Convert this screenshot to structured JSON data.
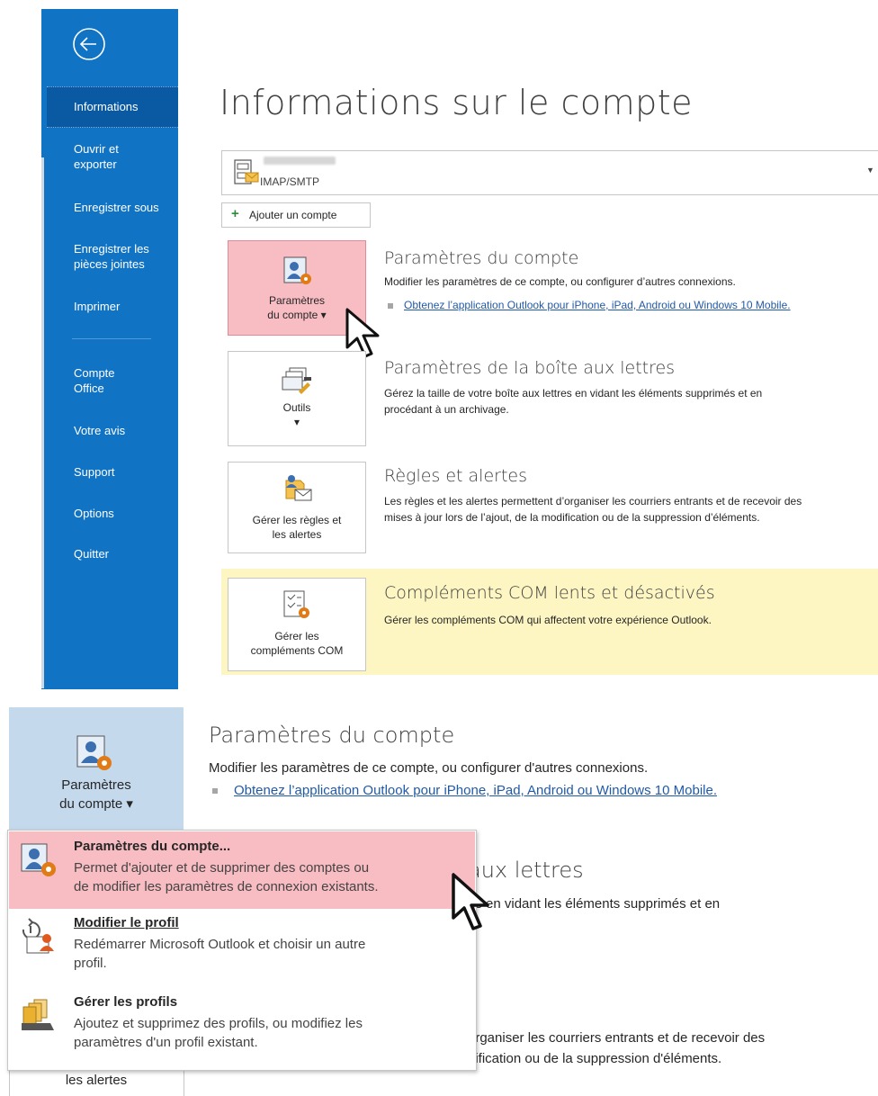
{
  "sidebar": {
    "items": [
      {
        "label": "Informations"
      },
      {
        "label": "Ouvrir et\nexporter"
      },
      {
        "label": "Enregistrer sous"
      },
      {
        "label": "Enregistrer les\npièces jointes"
      },
      {
        "label": "Imprimer"
      },
      {
        "label": "Compte\nOffice"
      },
      {
        "label": "Votre avis"
      },
      {
        "label": "Support"
      },
      {
        "label": "Options"
      },
      {
        "label": "Quitter"
      }
    ]
  },
  "main": {
    "title": "Informations sur le compte",
    "account": {
      "type": "IMAP/SMTP"
    },
    "add_account_label": "Ajouter un compte",
    "sections": [
      {
        "tile_label": "Paramètres\ndu compte ▾",
        "heading": "Paramètres du compte",
        "description": "Modifier les paramètres de ce compte, ou configurer d’autres connexions.",
        "link": "Obtenez l’application Outlook pour iPhone, iPad, Android ou Windows 10 Mobile."
      },
      {
        "tile_label": "Outils\n▾",
        "heading": "Paramètres de la boîte aux lettres",
        "description": "Gérez la taille de votre boîte aux lettres en vidant les éléments supprimés et en\nprocédant à un archivage."
      },
      {
        "tile_label": "Gérer les règles et\nles alertes",
        "heading": "Règles et alertes",
        "description": "Les règles et les alertes permettent d’organiser les courriers entrants et de recevoir des\nmises à jour lors de l’ajout, de la modification ou de la suppression d’éléments."
      },
      {
        "tile_label": "Gérer les\ncompléments COM",
        "heading": "Compléments COM lents et désactivés",
        "description": "Gérer les compléments COM qui affectent votre expérience Outlook."
      }
    ]
  },
  "zoom": {
    "tile_label": "Paramètres\ndu compte ▾",
    "heading": "Paramètres du compte",
    "description": "Modifier les paramètres de ce compte, ou configurer d'autres connexions.",
    "link": "Obtenez l’application Outlook pour iPhone, iPad, Android ou Windows 10 Mobile.",
    "behind_heading": "aux lettres",
    "behind_text1": "es en vidant les éléments supprimés et en",
    "behind_text2": "organiser les courriers entrants et de recevoir des",
    "behind_text3": "dification ou de la suppression d'éléments.",
    "bottom_tile_label": "les alertes",
    "menu": [
      {
        "title": "Paramètres du compte...",
        "desc": "Permet d'ajouter et de supprimer des comptes ou\nde modifier les paramètres de connexion existants."
      },
      {
        "title": "Modifier le profil",
        "desc": "Redémarrer Microsoft Outlook et choisir un autre\nprofil."
      },
      {
        "title": "Gérer les profils",
        "desc": "Ajoutez et supprimez des profils, ou modifiez les\nparamètres d'un profil existant."
      }
    ]
  },
  "colors": {
    "sidebar": "#1173c4",
    "highlight": "#f8bcc3",
    "com_band": "#fdf6c3",
    "link": "#1f5aa8"
  }
}
